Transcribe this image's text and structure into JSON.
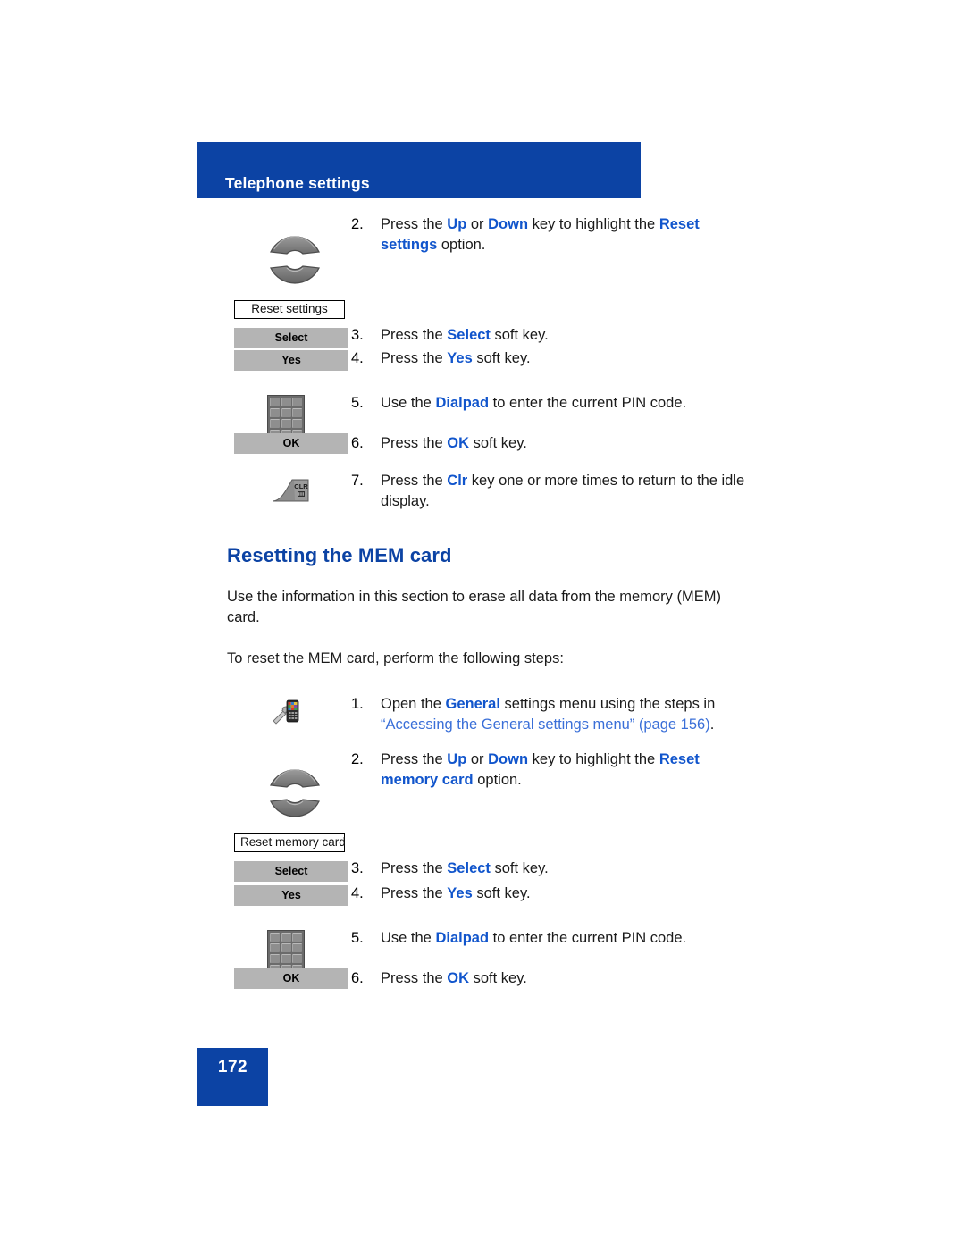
{
  "header": {
    "title": "Telephone settings"
  },
  "footer": {
    "page_number": "172"
  },
  "colors": {
    "brand_blue": "#0c43a4",
    "emphasis_blue": "#1155cc",
    "link_blue": "#3a6fd8",
    "softkey_gray": "#b4b4b4"
  },
  "procedure_one": {
    "steps": [
      {
        "number": "2.",
        "icon": "nav-rocker-icon",
        "text_parts": [
          {
            "t": "Press the ",
            "style": "plain"
          },
          {
            "t": "Up",
            "style": "bold-blue"
          },
          {
            "t": " or ",
            "style": "plain"
          },
          {
            "t": "Down",
            "style": "bold-blue"
          },
          {
            "t": " key to highlight the ",
            "style": "plain"
          },
          {
            "t": "Reset settings",
            "style": "bold-blue"
          },
          {
            "t": " option.",
            "style": "plain"
          }
        ]
      },
      {
        "number": "3.",
        "icon": "select-softkey",
        "menu_box_label": "Reset settings",
        "softkey_label": "Select",
        "text_parts": [
          {
            "t": "Press the ",
            "style": "plain"
          },
          {
            "t": "Select",
            "style": "bold-blue"
          },
          {
            "t": " soft key.",
            "style": "plain"
          }
        ]
      },
      {
        "number": "4.",
        "icon": "yes-softkey",
        "softkey_label": "Yes",
        "text_parts": [
          {
            "t": "Press the ",
            "style": "plain"
          },
          {
            "t": "Yes",
            "style": "bold-blue"
          },
          {
            "t": " soft key.",
            "style": "plain"
          }
        ]
      },
      {
        "number": "5.",
        "icon": "dialpad-icon",
        "text_parts": [
          {
            "t": "Use the ",
            "style": "plain"
          },
          {
            "t": "Dialpad",
            "style": "bold-blue"
          },
          {
            "t": " to enter the current PIN code.",
            "style": "plain"
          }
        ]
      },
      {
        "number": "6.",
        "icon": "ok-softkey",
        "softkey_label": "OK",
        "text_parts": [
          {
            "t": "Press the ",
            "style": "plain"
          },
          {
            "t": "OK",
            "style": "bold-blue"
          },
          {
            "t": " soft key.",
            "style": "plain"
          }
        ]
      },
      {
        "number": "7.",
        "icon": "clr-key-icon",
        "text_parts": [
          {
            "t": "Press the ",
            "style": "plain"
          },
          {
            "t": "Clr",
            "style": "bold-blue"
          },
          {
            "t": " key one or more times to return to the idle display.",
            "style": "plain"
          }
        ]
      }
    ]
  },
  "section": {
    "heading": "Resetting the MEM card",
    "paragraph_1": "Use the information in this section to erase all data from the memory (MEM) card.",
    "paragraph_2": "To reset the MEM card, perform the following steps:"
  },
  "procedure_two": {
    "steps": [
      {
        "number": "1.",
        "icon": "general-settings-icon",
        "text_parts": [
          {
            "t": "Open the ",
            "style": "plain"
          },
          {
            "t": "General",
            "style": "bold-blue"
          },
          {
            "t": " settings menu using the steps in ",
            "style": "plain"
          },
          {
            "t": "“Accessing the General settings menu” (page 156)",
            "style": "link"
          },
          {
            "t": ".",
            "style": "plain"
          }
        ]
      },
      {
        "number": "2.",
        "icon": "nav-rocker-icon",
        "text_parts": [
          {
            "t": "Press the ",
            "style": "plain"
          },
          {
            "t": "Up",
            "style": "bold-blue"
          },
          {
            "t": " or ",
            "style": "plain"
          },
          {
            "t": "Down",
            "style": "bold-blue"
          },
          {
            "t": " key to highlight the ",
            "style": "plain"
          },
          {
            "t": "Reset memory card",
            "style": "bold-blue"
          },
          {
            "t": " option.",
            "style": "plain"
          }
        ]
      },
      {
        "number": "3.",
        "icon": "select-softkey",
        "menu_box_label": "Reset memory card",
        "softkey_label": "Select",
        "text_parts": [
          {
            "t": "Press the ",
            "style": "plain"
          },
          {
            "t": "Select",
            "style": "bold-blue"
          },
          {
            "t": " soft key.",
            "style": "plain"
          }
        ]
      },
      {
        "number": "4.",
        "icon": "yes-softkey",
        "softkey_label": "Yes",
        "text_parts": [
          {
            "t": "Press the ",
            "style": "plain"
          },
          {
            "t": "Yes",
            "style": "bold-blue"
          },
          {
            "t": " soft key.",
            "style": "plain"
          }
        ]
      },
      {
        "number": "5.",
        "icon": "dialpad-icon",
        "text_parts": [
          {
            "t": "Use the ",
            "style": "plain"
          },
          {
            "t": "Dialpad",
            "style": "bold-blue"
          },
          {
            "t": " to enter the current PIN code.",
            "style": "plain"
          }
        ]
      },
      {
        "number": "6.",
        "icon": "ok-softkey",
        "softkey_label": "OK",
        "text_parts": [
          {
            "t": "Press the ",
            "style": "plain"
          },
          {
            "t": "OK",
            "style": "bold-blue"
          },
          {
            "t": " soft key.",
            "style": "plain"
          }
        ]
      }
    ]
  },
  "icon_labels": {
    "clr_key_text": "CLR"
  }
}
